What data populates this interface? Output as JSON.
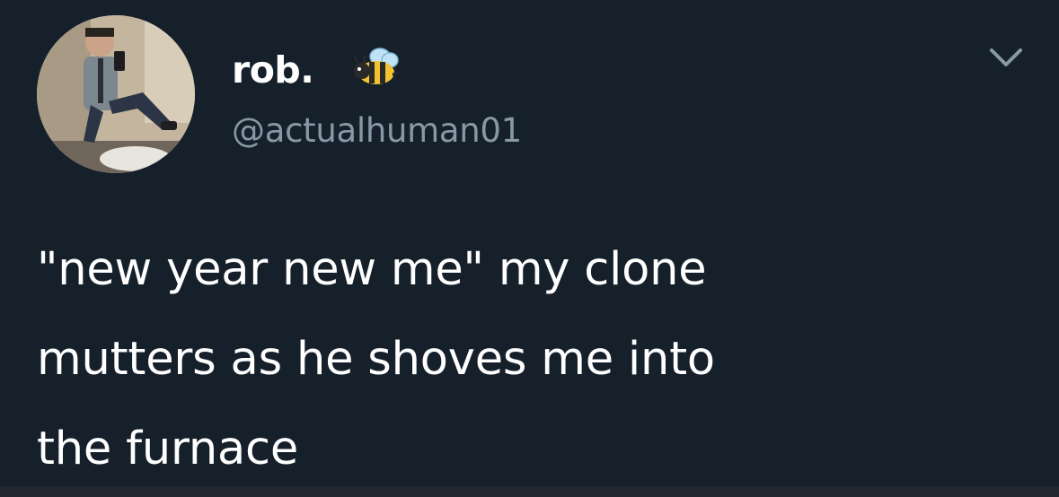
{
  "user": {
    "display_name": "rob.",
    "handle": "@actualhuman01",
    "badge_icon": "bee-emoji-icon",
    "avatar_icon": "profile-photo-icon"
  },
  "menu": {
    "icon": "chevron-down-icon"
  },
  "tweet": {
    "lines": [
      "\"new year new me\" my clone",
      "mutters as he shoves me into",
      "the furnace"
    ]
  },
  "colors": {
    "background": "#15202b",
    "text": "#ffffff",
    "secondary_text": "#8899a6"
  }
}
